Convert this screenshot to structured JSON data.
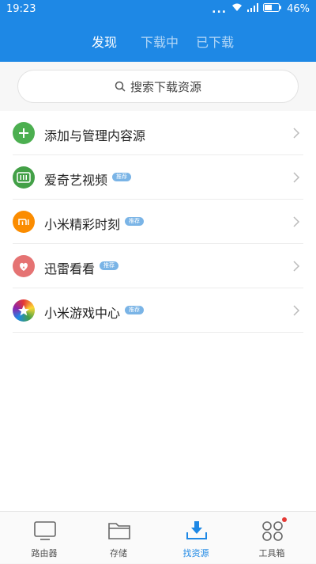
{
  "status_bar": {
    "time": "19:23",
    "battery": "46%",
    "dots": "..."
  },
  "tabs": [
    {
      "label": "发现",
      "active": true
    },
    {
      "label": "下载中",
      "active": false
    },
    {
      "label": "已下载",
      "active": false
    }
  ],
  "search": {
    "placeholder": "搜索下载资源"
  },
  "list": [
    {
      "label": "添加与管理内容源",
      "icon": "plus-icon",
      "color": "#4caf50",
      "badge": ""
    },
    {
      "label": "爱奇艺视频",
      "icon": "iqiyi-icon",
      "color": "#43a047",
      "badge": "推荐"
    },
    {
      "label": "小米精彩时刻",
      "icon": "mi-icon",
      "color": "#fb8c00",
      "badge": "推荐"
    },
    {
      "label": "迅雷看看",
      "icon": "xunlei-icon",
      "color": "#e57373",
      "badge": "推荐"
    },
    {
      "label": "小米游戏中心",
      "icon": "star-icon",
      "color": "#7e57c2",
      "badge": "推荐"
    }
  ],
  "bottom_nav": [
    {
      "label": "路由器",
      "icon": "router-icon",
      "active": false
    },
    {
      "label": "存储",
      "icon": "folder-icon",
      "active": false
    },
    {
      "label": "找资源",
      "icon": "download-tray-icon",
      "active": true
    },
    {
      "label": "工具箱",
      "icon": "toolbox-icon",
      "active": false
    }
  ],
  "colors": {
    "primary": "#1e88e5",
    "badge": "#7ab4e6",
    "notification": "#e53935"
  }
}
